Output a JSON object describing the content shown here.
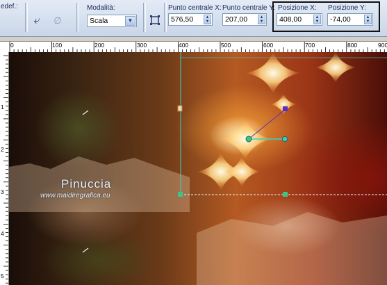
{
  "toolbar": {
    "preset_label": "edef.:",
    "mode_label": "Modalità:",
    "mode_value": "Scala",
    "center_x_label": "Punto centrale X:",
    "center_x_value": "576,50",
    "center_y_label": "Punto centrale Y:",
    "center_y_value": "207,00",
    "pos_x_label": "Posizione X:",
    "pos_x_value": "408,00",
    "pos_y_label": "Posizione Y:",
    "pos_y_value": "-74,00",
    "icons": [
      "apply-icon",
      "reset-icon",
      "deformation-mode-icon"
    ]
  },
  "ruler": {
    "h_labels": [
      "0",
      "100",
      "200",
      "300",
      "400",
      "500",
      "600",
      "700",
      "800",
      "900"
    ],
    "v_labels": [
      "1",
      "2",
      "3",
      "4",
      "5"
    ]
  },
  "canvas": {
    "watermark_name": "Pinuccia",
    "watermark_url": "www.maidiregrafica.eu"
  },
  "colors": {
    "toolbar_bg": "#d6e1f0",
    "highlight_border": "#111111",
    "guide_line": "#3ad2c8",
    "handle_purple": "#5a2fc0",
    "handle_green": "#3cc58a"
  }
}
